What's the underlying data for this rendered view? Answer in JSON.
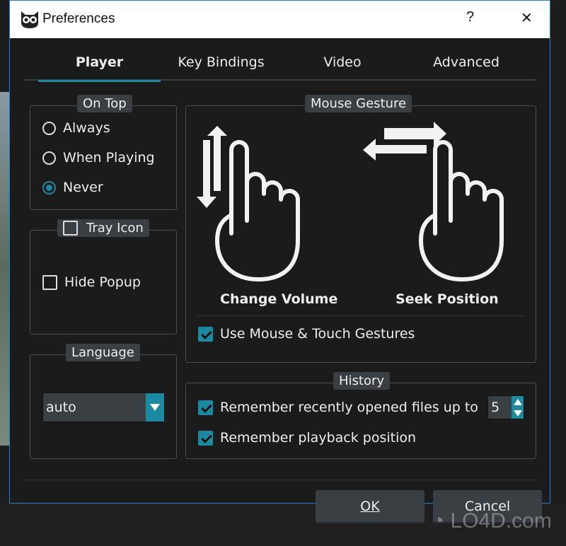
{
  "window": {
    "title": "Preferences",
    "help": "?",
    "close": "✕"
  },
  "tabs": [
    {
      "label": "Player",
      "active": true
    },
    {
      "label": "Key Bindings"
    },
    {
      "label": "Video"
    },
    {
      "label": "Advanced"
    }
  ],
  "on_top": {
    "title": "On Top",
    "options": [
      {
        "label": "Always",
        "selected": false
      },
      {
        "label": "When Playing",
        "selected": false
      },
      {
        "label": "Never",
        "selected": true
      }
    ]
  },
  "tray": {
    "title": "Tray Icon",
    "checked": false,
    "hide_popup": "Hide Popup",
    "hide_popup_checked": false
  },
  "language": {
    "title": "Language",
    "value": "auto"
  },
  "gesture": {
    "title": "Mouse Gesture",
    "volume": "Change Volume",
    "seek": "Seek Position",
    "use_label": "Use Mouse & Touch Gestures",
    "use_checked": true
  },
  "history": {
    "title": "History",
    "recent_label": "Remember recently opened files up to",
    "recent_value": "5",
    "recent_checked": true,
    "playback_label": "Remember playback position",
    "playback_checked": true
  },
  "buttons": {
    "ok": "OK",
    "cancel": "Cancel"
  },
  "colors": {
    "accent": "#1a8aa0",
    "bg": "#1b1b1b",
    "group_label": "#3a3f44"
  },
  "watermark": "LO4D.com"
}
